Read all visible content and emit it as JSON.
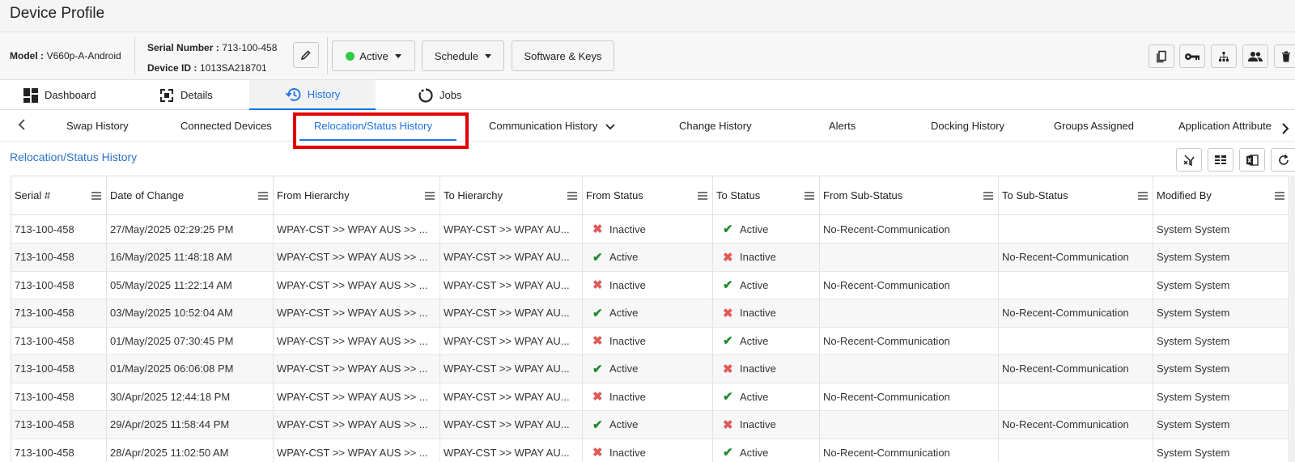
{
  "page": {
    "title": "Device Profile"
  },
  "device": {
    "model_label": "Model :",
    "model_value": "V660p-A-Android",
    "serial_label": "Serial Number :",
    "serial_value": "713-100-458",
    "device_id_label": "Device ID :",
    "device_id_value": "1013SA218701"
  },
  "toolbar": {
    "status_label": "Active",
    "status_color": "#2ecc40",
    "schedule_label": "Schedule",
    "software_label": "Software & Keys",
    "right_icons": [
      "copy-icon",
      "key-icon",
      "hierarchy-icon",
      "users-icon",
      "delete-icon"
    ]
  },
  "main_tabs": [
    {
      "label": "Dashboard",
      "icon": "dashboard-icon"
    },
    {
      "label": "Details",
      "icon": "details-icon"
    },
    {
      "label": "History",
      "icon": "history-icon",
      "active": true
    },
    {
      "label": "Jobs",
      "icon": "jobs-icon"
    }
  ],
  "sub_tabs": [
    {
      "label": "Swap History"
    },
    {
      "label": "Connected Devices"
    },
    {
      "label": "Relocation/Status History",
      "active": true
    },
    {
      "label": "Communication History"
    },
    {
      "label": "Change History"
    },
    {
      "label": "Alerts"
    },
    {
      "label": "Docking History"
    },
    {
      "label": "Groups Assigned"
    },
    {
      "label": "Application Attribute"
    }
  ],
  "section": {
    "title": "Relocation/Status History"
  },
  "table": {
    "headers": [
      "Serial #",
      "Date of Change",
      "From Hierarchy",
      "To Hierarchy",
      "From Status",
      "To Status",
      "From Sub-Status",
      "To Sub-Status",
      "Modified By"
    ],
    "rows": [
      {
        "serial": "713-100-458",
        "date": "27/May/2025 02:29:25 PM",
        "from_h": "WPAY-CST >> WPAY AUS >> ...",
        "to_h": "WPAY-CST >> WPAY AU...",
        "from_s": "Inactive",
        "to_s": "Active",
        "from_sub": "No-Recent-Communication",
        "to_sub": "",
        "by": "System System"
      },
      {
        "serial": "713-100-458",
        "date": "16/May/2025 11:48:18 AM",
        "from_h": "WPAY-CST >> WPAY AUS >> ...",
        "to_h": "WPAY-CST >> WPAY AU...",
        "from_s": "Active",
        "to_s": "Inactive",
        "from_sub": "",
        "to_sub": "No-Recent-Communication",
        "by": "System System"
      },
      {
        "serial": "713-100-458",
        "date": "05/May/2025 11:22:14 AM",
        "from_h": "WPAY-CST >> WPAY AUS >> ...",
        "to_h": "WPAY-CST >> WPAY AU...",
        "from_s": "Inactive",
        "to_s": "Active",
        "from_sub": "No-Recent-Communication",
        "to_sub": "",
        "by": "System System"
      },
      {
        "serial": "713-100-458",
        "date": "03/May/2025 10:52:04 AM",
        "from_h": "WPAY-CST >> WPAY AUS >> ...",
        "to_h": "WPAY-CST >> WPAY AU...",
        "from_s": "Active",
        "to_s": "Inactive",
        "from_sub": "",
        "to_sub": "No-Recent-Communication",
        "by": "System System"
      },
      {
        "serial": "713-100-458",
        "date": "01/May/2025 07:30:45 PM",
        "from_h": "WPAY-CST >> WPAY AUS >> ...",
        "to_h": "WPAY-CST >> WPAY AU...",
        "from_s": "Inactive",
        "to_s": "Active",
        "from_sub": "No-Recent-Communication",
        "to_sub": "",
        "by": "System System"
      },
      {
        "serial": "713-100-458",
        "date": "01/May/2025 06:06:08 PM",
        "from_h": "WPAY-CST >> WPAY AUS >> ...",
        "to_h": "WPAY-CST >> WPAY AU...",
        "from_s": "Active",
        "to_s": "Inactive",
        "from_sub": "",
        "to_sub": "No-Recent-Communication",
        "by": "System System"
      },
      {
        "serial": "713-100-458",
        "date": "30/Apr/2025 12:44:18 PM",
        "from_h": "WPAY-CST >> WPAY AUS >> ...",
        "to_h": "WPAY-CST >> WPAY AU...",
        "from_s": "Inactive",
        "to_s": "Active",
        "from_sub": "No-Recent-Communication",
        "to_sub": "",
        "by": "System System"
      },
      {
        "serial": "713-100-458",
        "date": "29/Apr/2025 11:58:44 PM",
        "from_h": "WPAY-CST >> WPAY AUS >> ...",
        "to_h": "WPAY-CST >> WPAY AU...",
        "from_s": "Active",
        "to_s": "Inactive",
        "from_sub": "",
        "to_sub": "No-Recent-Communication",
        "by": "System System"
      },
      {
        "serial": "713-100-458",
        "date": "28/Apr/2025 11:02:50 AM",
        "from_h": "WPAY-CST >> WPAY AUS >> ...",
        "to_h": "WPAY-CST >> WPAY AU...",
        "from_s": "Inactive",
        "to_s": "Active",
        "from_sub": "No-Recent-Communication",
        "to_sub": "",
        "by": "System System"
      }
    ]
  },
  "colors": {
    "accent": "#1a73e8",
    "highlight": "#e00000",
    "success": "#1f8a2b",
    "error": "#e05a5a"
  }
}
